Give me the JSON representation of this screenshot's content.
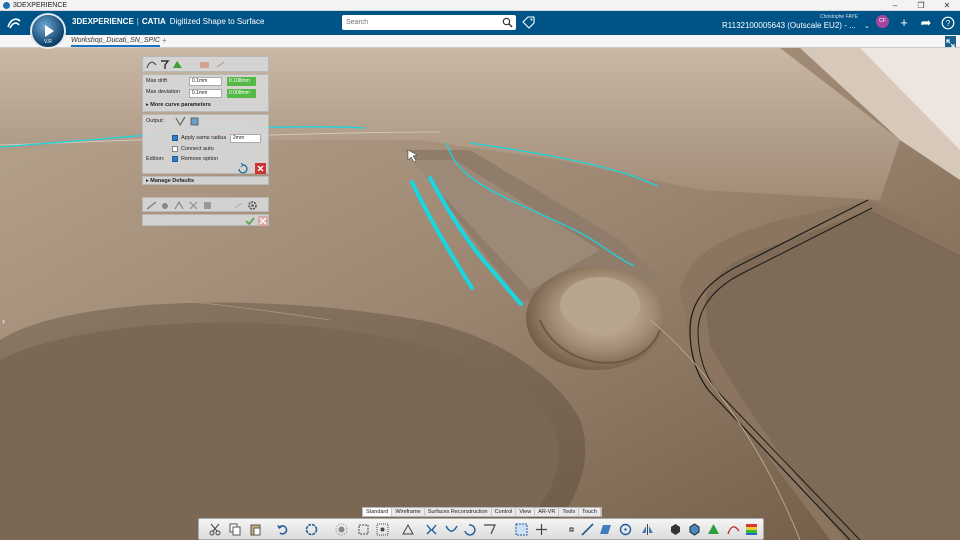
{
  "os_bar": {
    "title": "3DEXPERIENCE"
  },
  "header": {
    "compass_version": "V.R",
    "brand_3d": "3DEXPERIENCE",
    "brand_sep": "|",
    "brand_app": "CATIA",
    "brand_module": "Digitized Shape to Surface",
    "search_placeholder": "Search",
    "user_name": "Christophe FAYE",
    "tenant": "R1132100005643  (Outscale EU2) - ...",
    "avatar_initials": "CF"
  },
  "tabs": {
    "document": "Workshop_Ducati_SN_SPIC",
    "add": "+"
  },
  "panel": {
    "max_drift_label": "Max drift",
    "max_drift_value": "0.1mm",
    "max_drift_result": "0.108mm",
    "max_deviation_label": "Max deviation",
    "max_deviation_value": "0.1mm",
    "max_deviation_result": "0.008mm",
    "more_params": "More curve parameters",
    "output_label": "Output:",
    "apply_radius": "Apply same radius",
    "radius_value": "2mm",
    "connect_auto": "Connect auto",
    "edition_label": "Edition:",
    "remove_option": "Remove option",
    "manage_defaults": "Manage Defaults"
  },
  "bottom_tabs": [
    "Standard",
    "Wireframe",
    "Surfaces Reconstruction",
    "Control",
    "View",
    "AR-VR",
    "Tools",
    "Touch"
  ],
  "colors": {
    "header": "#005386",
    "curve": "#19d6e0",
    "surface": "#8a7560"
  }
}
